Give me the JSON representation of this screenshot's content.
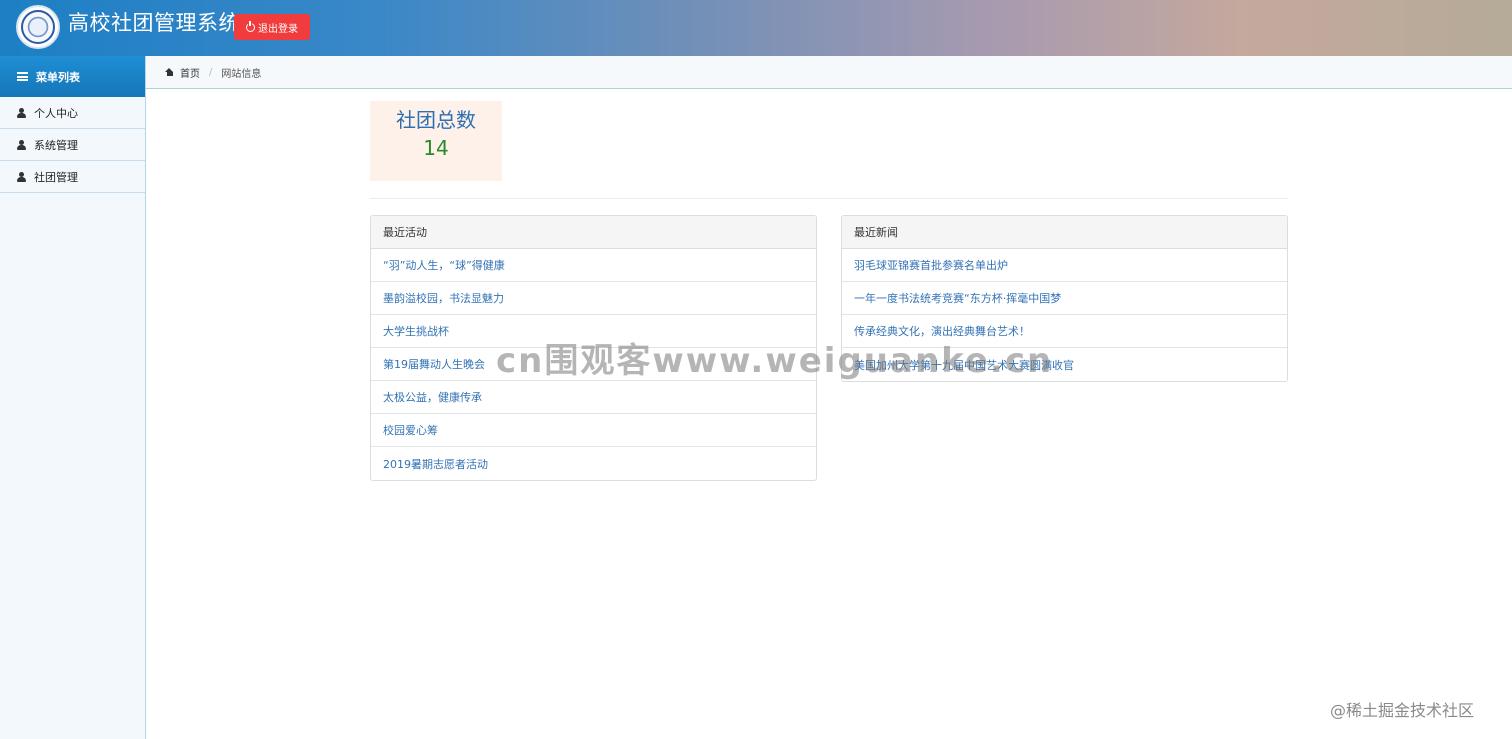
{
  "header": {
    "title": "高校社团管理系统",
    "logout_label": "退出登录"
  },
  "sidebar": {
    "menu_title": "菜单列表",
    "items": [
      {
        "label": "个人中心"
      },
      {
        "label": "系统管理"
      },
      {
        "label": "社团管理"
      }
    ]
  },
  "breadcrumb": {
    "home": "首页",
    "current": "网站信息"
  },
  "stats": {
    "label": "社团总数",
    "value": "14"
  },
  "activities": {
    "title": "最近活动",
    "items": [
      "“羽”动人生，“球”得健康",
      "墨韵溢校园，书法显魅力",
      "大学生挑战杯",
      "第19届舞动人生晚会",
      "太极公益，健康传承",
      "校园爱心筹",
      "2019暑期志愿者活动"
    ]
  },
  "news": {
    "title": "最近新闻",
    "items": [
      "羽毛球亚锦赛首批参赛名单出炉",
      "一年一度书法统考竞赛“东方杯·挥毫中国梦",
      "传承经典文化，演出经典舞台艺术！",
      "美国加州大学第十九届中国艺术大赛圆满收官"
    ]
  },
  "watermark": "cn围观客www.weiguanke.cn",
  "footer_mark": "@稀土掘金技术社区"
}
